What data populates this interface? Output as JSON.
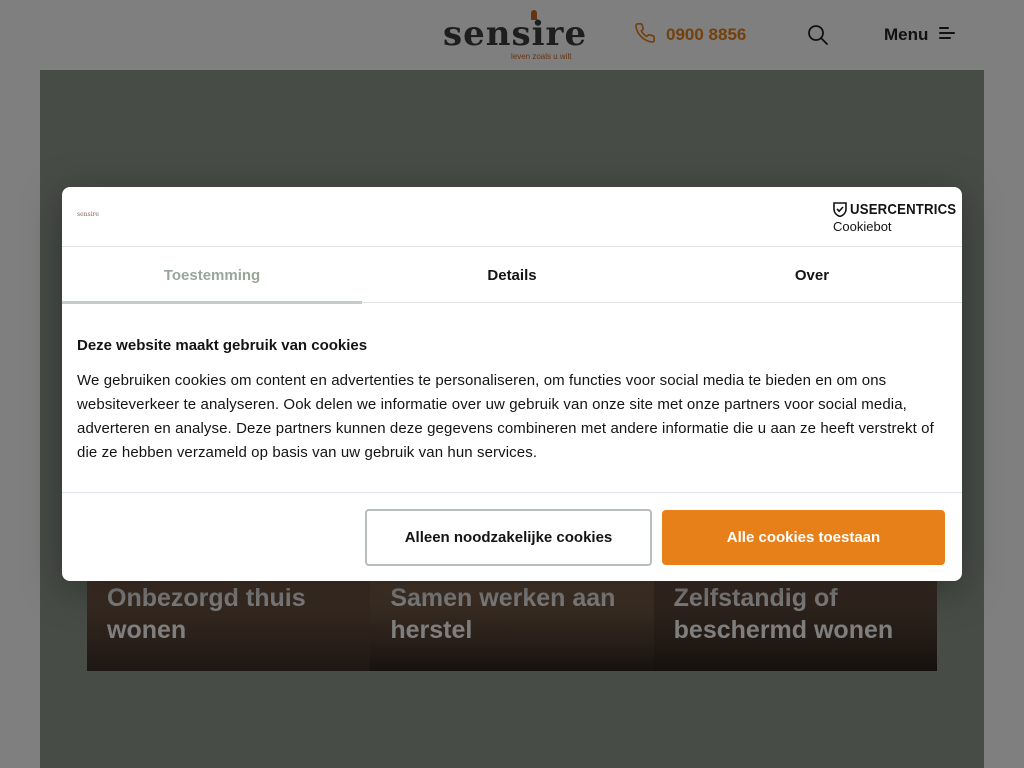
{
  "header": {
    "logo_text": "sensire",
    "logo_tagline": "leven zoals u wilt",
    "phone_number": "0900 8856",
    "menu_label": "Menu",
    "icons": {
      "phone": "phone-icon",
      "search": "search-icon",
      "menu": "hamburger-icon"
    },
    "accent_color": "#e88019"
  },
  "cards": [
    {
      "title": "Onbezorgd thuis wonen"
    },
    {
      "title": "Samen werken aan herstel"
    },
    {
      "title": "Zelfstandig of beschermd wonen"
    }
  ],
  "cookie_dialog": {
    "provider_name": "USERCENTRICS",
    "provider_sub": "Cookiebot",
    "mini_logo": "sensire",
    "tabs": [
      {
        "label": "Toestemming",
        "active": true
      },
      {
        "label": "Details",
        "active": false
      },
      {
        "label": "Over",
        "active": false
      }
    ],
    "title": "Deze website maakt gebruik van cookies",
    "body": "We gebruiken cookies om content en advertenties te personaliseren, om functies voor social media te bieden en om ons websiteverkeer te analyseren. Ook delen we informatie over uw gebruik van onze site met onze partners voor social media, adverteren en analyse. Deze partners kunnen deze gegevens combineren met andere informatie die u aan ze heeft verstrekt of die ze hebben verzameld op basis van uw gebruik van hun services.",
    "button_necessary": "Alleen noodzakelijke cookies",
    "button_all": "Alle cookies toestaan",
    "colors": {
      "primary": "#e88019",
      "tab_active": "#9aa69a"
    }
  }
}
